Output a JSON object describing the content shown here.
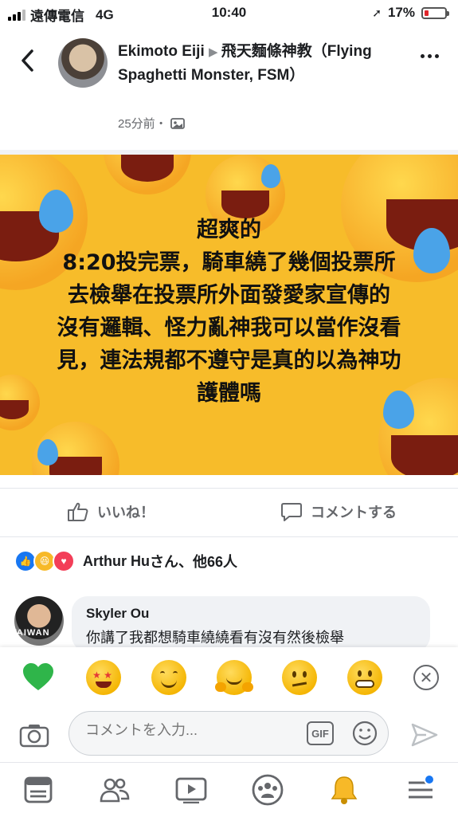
{
  "status": {
    "carrier": "遠傳電信",
    "network": "4G",
    "time": "10:40",
    "battery": "17%"
  },
  "post": {
    "author": "Ekimoto Eiji",
    "group": "飛天麵條神教（Flying Spaghetti Monster, FSM）",
    "time": "25分前・",
    "image_text_lines": [
      "超爽的",
      "8:20投完票，騎車繞了幾個投票所",
      "去檢舉在投票所外面發愛家宣傳的",
      "沒有邏輯、怪力亂神我可以當作沒看",
      "見，連法規都不遵守是真的以為神功",
      "護體嗎"
    ]
  },
  "actions": {
    "like_label": "いいね！",
    "comment_label": "コメントする"
  },
  "reactions": {
    "summary_name": "Arthur Hu",
    "summary_suffix": "さん、他66人"
  },
  "comment": {
    "name": "Skyler Ou",
    "text": "你講了我都想騎車繞繞看有沒有然後檢舉",
    "avatar_label": "TAIWAN"
  },
  "composer": {
    "placeholder": "コメントを入力...",
    "gif_label": "GIF"
  },
  "colors": {
    "accent": "#1877f2",
    "banner": "#f7bc2a",
    "heart": "#f33e58"
  },
  "icons": [
    "back-icon",
    "more-icon",
    "like-icon",
    "comment-icon",
    "camera-icon",
    "smiley-icon",
    "send-icon",
    "close-icon",
    "news-feed-icon",
    "friends-icon",
    "watch-icon",
    "groups-icon",
    "notifications-icon",
    "menu-icon"
  ]
}
